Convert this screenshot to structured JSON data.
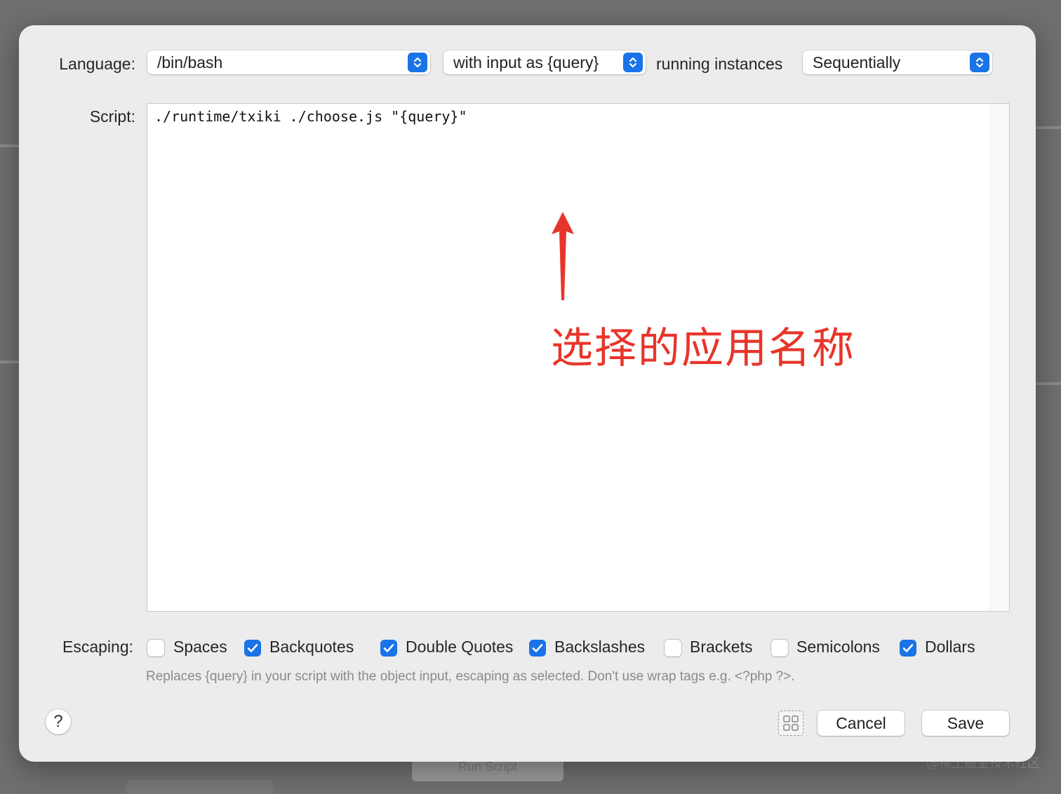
{
  "language": {
    "label": "Language:",
    "value": "/bin/bash",
    "input_mode": "with input as {query}",
    "instances_label": "running instances",
    "instances_value": "Sequentially"
  },
  "script": {
    "label": "Script:",
    "content": "./runtime/txiki ./choose.js \"{query}\"",
    "annotation": "选择的应用名称"
  },
  "escaping": {
    "label": "Escaping:",
    "options": [
      {
        "label": "Spaces",
        "checked": false
      },
      {
        "label": "Backquotes",
        "checked": true
      },
      {
        "label": "Double Quotes",
        "checked": true
      },
      {
        "label": "Backslashes",
        "checked": true
      },
      {
        "label": "Brackets",
        "checked": false
      },
      {
        "label": "Semicolons",
        "checked": false
      },
      {
        "label": "Dollars",
        "checked": true
      }
    ],
    "help_text": "Replaces {query} in your script with the object input, escaping as selected. Don't use wrap tags e.g. <?php ?>."
  },
  "footer": {
    "help": "?",
    "cancel": "Cancel",
    "save": "Save"
  },
  "background": {
    "tab_label": "Run Script",
    "watermark": "@稀土掘金技术社区"
  },
  "colors": {
    "accent": "#1a73e8",
    "annotation": "#e8352a"
  }
}
